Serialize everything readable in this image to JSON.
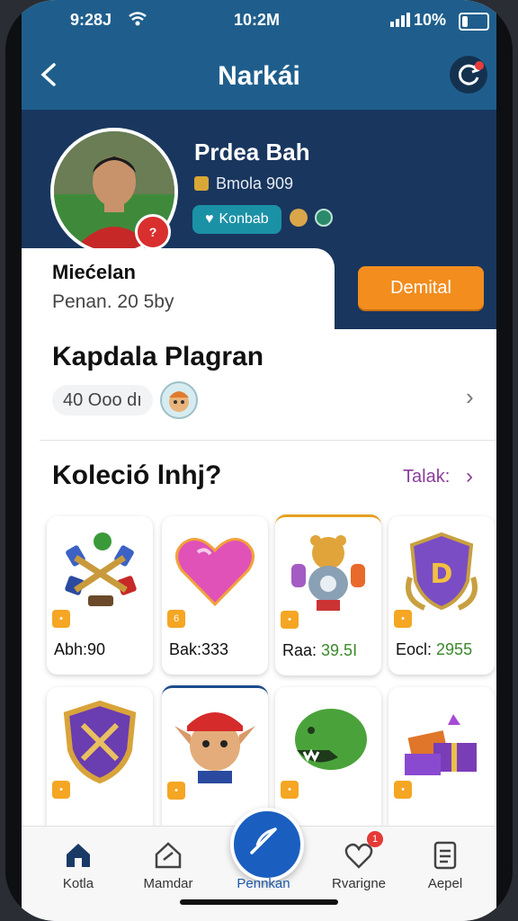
{
  "status_bar": {
    "time_left": "9:28J",
    "time_center": "10:2M",
    "battery": "10%"
  },
  "header": {
    "title": "Narkái"
  },
  "profile": {
    "name": "Prdea Bah",
    "sub": "Bmola 909",
    "pill": "Konbab",
    "card_title": "Miećelan",
    "card_sub": "Penan. 20 5by",
    "button_label": "Demital"
  },
  "program": {
    "title": "Kapdala Plagran",
    "chip": "40 Ooo dı"
  },
  "collection": {
    "title": "Koleció lnhj?",
    "link": "Talak:",
    "items": [
      {
        "prefix": "Abh:",
        "value": "90",
        "tag": "•",
        "art": "rattles"
      },
      {
        "prefix": "Bak:",
        "value": "333",
        "tag": "6",
        "art": "heart"
      },
      {
        "prefix": "Raa: ",
        "value": "39.5I",
        "tag": "•",
        "art": "bear"
      },
      {
        "prefix": "Eocl: ",
        "value": "2955",
        "tag": "•",
        "art": "shield"
      },
      {
        "prefix": "",
        "value": "",
        "tag": "•",
        "art": "shield2"
      },
      {
        "prefix": "",
        "value": "",
        "tag": "•",
        "art": "elf"
      },
      {
        "prefix": "",
        "value": "",
        "tag": "•",
        "art": "monster"
      },
      {
        "prefix": "",
        "value": "",
        "tag": "•",
        "art": "gifts"
      }
    ]
  },
  "bottom_nav": {
    "items": [
      {
        "label": "Kotla"
      },
      {
        "label": "Mamdar"
      },
      {
        "label": "Pennkan"
      },
      {
        "label": "Rvarigne"
      },
      {
        "label": "Aepel"
      }
    ],
    "notification_count": "1"
  },
  "colors": {
    "header_bg": "#1f5e8c",
    "profile_band": "#19365e",
    "accent_orange": "#f28d1e",
    "accent_blue": "#1a5fbf",
    "link_purple": "#8a3d9a"
  }
}
